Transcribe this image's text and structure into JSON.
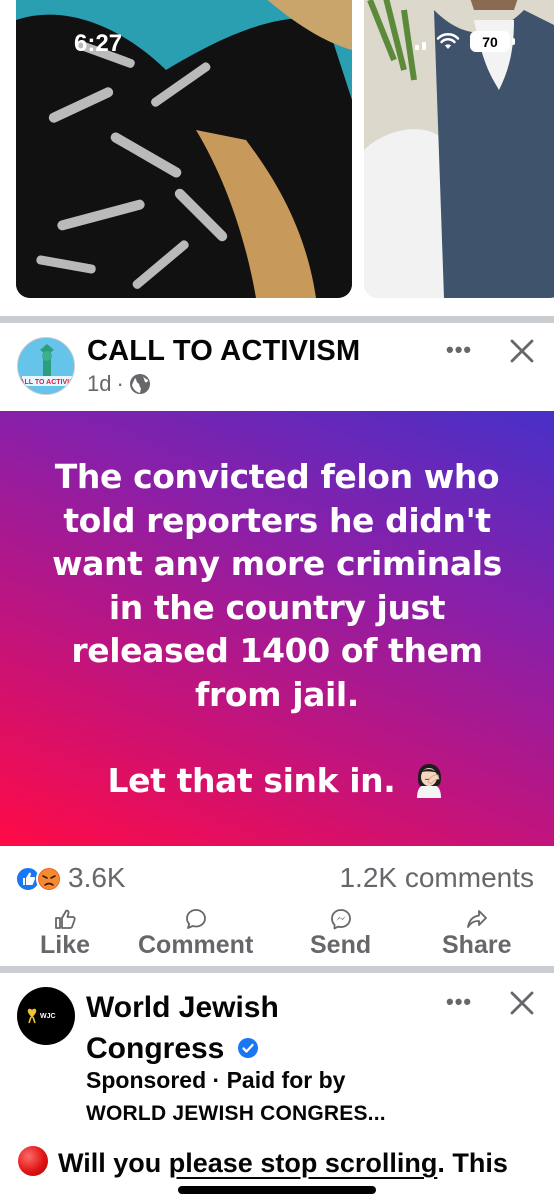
{
  "status_bar": {
    "time": "6:27",
    "battery": "70"
  },
  "post": {
    "page_name": "CALL TO ACTIVISM",
    "time_ago": "1d",
    "separator": "·",
    "more_label": "•••",
    "body_lines": [
      "The convicted felon who",
      "told reporters he didn't",
      "want any more criminals",
      "in the country just",
      "released 1400 of them",
      "from jail."
    ],
    "body_closing": "Let that sink in.",
    "reaction_count": "3.6K",
    "comments_count": "1.2K comments",
    "actions": {
      "like": "Like",
      "comment": "Comment",
      "send": "Send",
      "share": "Share"
    }
  },
  "ad": {
    "name_line1": "World Jewish",
    "name_line2": "Congress",
    "sponsored": "Sponsored",
    "paid_by": "Paid for by",
    "paid_by_org": "WORLD JEWISH CONGRES...",
    "more_label": "•••",
    "text_start": "Will you ",
    "text_underlined": "please stop scrolling",
    "text_end": ". This"
  },
  "colors": {
    "gradient_start": "#ff0a46",
    "gradient_end": "#4830c8",
    "muted_text": "#65676b",
    "like_blue": "#1877f2",
    "angry_orange": "#f05e2b"
  }
}
